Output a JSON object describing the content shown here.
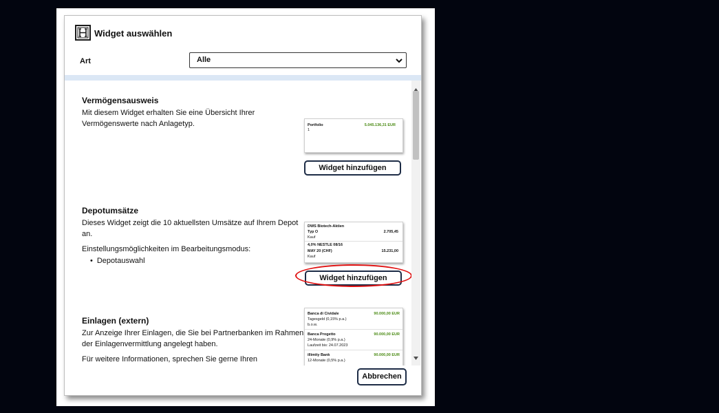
{
  "dialog": {
    "title": "Widget auswählen",
    "logo_icon": "hypo-logo-icon",
    "filter": {
      "label": "Art",
      "selected": "Alle"
    },
    "cancel_label": "Abbrechen"
  },
  "widgets": [
    {
      "title": "Vermögensausweis",
      "desc1": "Mit diesem Widget erhalten Sie eine Übersicht Ihrer",
      "desc2": "Vermögenswerte nach Anlagetyp.",
      "button_label": "Widget hinzufügen",
      "preview": {
        "label": "Portfolio",
        "sub": "1",
        "value": "5.045.136,31 EUR"
      }
    },
    {
      "title": "Depotumsätze",
      "desc1": "Dieses Widget zeigt die 10 aktuellsten Umsätze auf Ihrem Depot",
      "desc2": "an.",
      "settings_label": "Einstellungsmöglichkeiten im Bearbeitungsmodus:",
      "settings_item": "Depotauswahl",
      "button_label": "Widget hinzufügen",
      "preview": {
        "rows": [
          {
            "name1": "DWS Biotech-Aktien",
            "name2": "Typ O",
            "value": "2.705,45",
            "type": "Kauf"
          },
          {
            "name1": "4,0% NESTLE 08/16",
            "name2": "MAY 20 (CHF)",
            "value": "15.231,00",
            "type": "Kauf"
          }
        ]
      }
    },
    {
      "title": "Einlagen (extern)",
      "desc1": "Zur Anzeige Ihrer Einlagen, die Sie bei Partnerbanken im Rahmen",
      "desc2": "der Einlagenvermittlung angelegt haben.",
      "desc3": "Für weitere Informationen, sprechen Sie gerne Ihren",
      "preview": {
        "rows": [
          {
            "bank": "Banca di Cividale",
            "value": "90.000,00 EUR",
            "line2": "Tagesgeld (0,15% p.a.)",
            "line3": "b.o.w."
          },
          {
            "bank": "Banca Progetto",
            "value": "90.000,00 EUR",
            "line2": "24-Monate (0,9% p.a.)",
            "line3": "Laufzeit bis: 24.07.2023"
          },
          {
            "bank": "illimity Bank",
            "value": "90.000,00 EUR",
            "line2": "12-Monate (0,5% p.a.)",
            "line3": ""
          }
        ]
      }
    }
  ],
  "colors": {
    "accent_border": "#1c2b45",
    "highlight": "#e01010",
    "value_green": "#4a8a13",
    "band": "#dbe7f5"
  }
}
